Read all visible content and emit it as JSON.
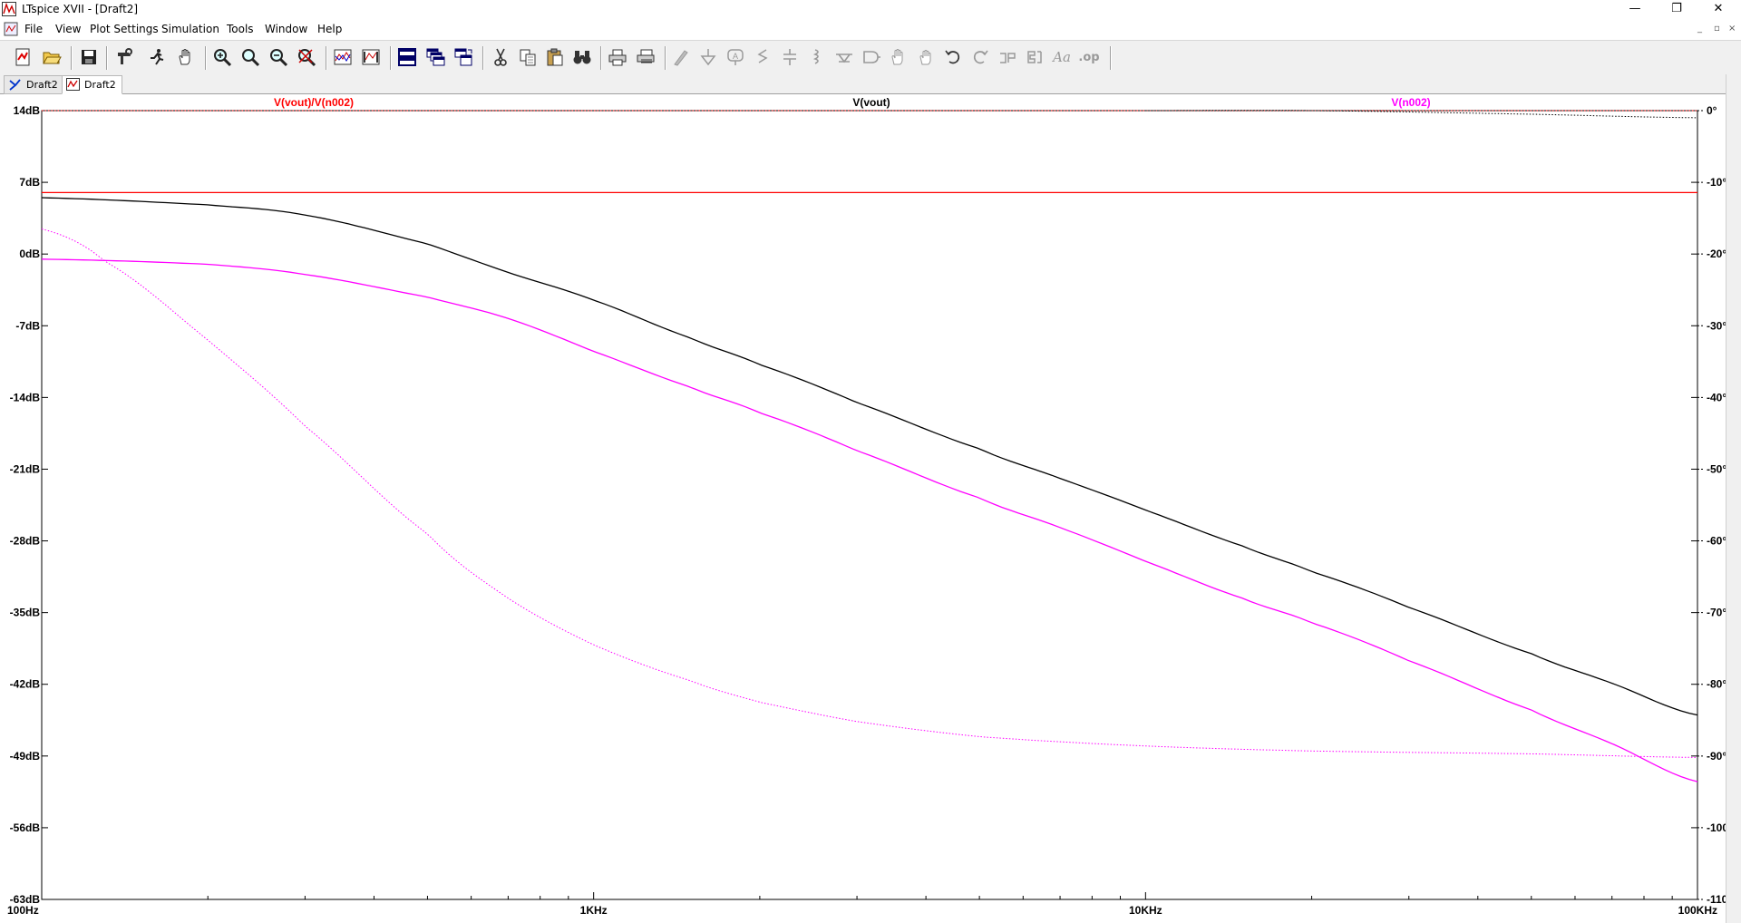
{
  "window": {
    "title": "LTspice XVII - [Draft2]",
    "minimize_glyph": "—",
    "restore_glyph": "❐",
    "close_glyph": "✕"
  },
  "menu": {
    "items": [
      "File",
      "View",
      "Plot Settings",
      "Simulation",
      "Tools",
      "Window",
      "Help"
    ],
    "mdi_minimize": "_",
    "mdi_restore": "▫",
    "mdi_close": "×"
  },
  "toolbar": {
    "icons": [
      "new-schematic-icon",
      "open-icon",
      "save-icon",
      "control-panel-icon",
      "run-icon",
      "halt-icon",
      "zoom-in-icon",
      "zoom-area-icon",
      "zoom-out-icon",
      "zoom-full-icon",
      "autorange-icon",
      "pick-visible-traces-icon",
      "tile-horizontal-icon",
      "cascade-icon",
      "tile-vertical-icon",
      "cut-icon",
      "copy-icon",
      "paste-icon",
      "find-icon",
      "print-icon",
      "print-preview-icon",
      "wire-icon",
      "ground-icon",
      "label-net-icon",
      "resistor-icon",
      "capacitor-icon",
      "inductor-icon",
      "diode-icon",
      "component-icon",
      "move-icon",
      "drag-icon",
      "undo-icon",
      "redo-icon",
      "rotate-icon",
      "mirror-icon",
      "text-icon",
      "spice-directive-icon"
    ],
    "spice_directive_glyph": ".op",
    "text_glyph": "Aa"
  },
  "tabs": [
    {
      "label": "Draft2",
      "icon": "schematic-icon",
      "active": false
    },
    {
      "label": "Draft2",
      "icon": "waveform-icon",
      "active": true
    }
  ],
  "chart_data": {
    "type": "line",
    "x_scale": "log",
    "xlim": [
      100,
      100000
    ],
    "x_ticks": [
      {
        "value": 100,
        "label": "100Hz"
      },
      {
        "value": 1000,
        "label": "1KHz"
      },
      {
        "value": 10000,
        "label": "10KHz"
      },
      {
        "value": 100000,
        "label": "100KHz"
      }
    ],
    "y_left": {
      "unit": "dB",
      "ylim": [
        -63,
        14
      ],
      "ticks": [
        14,
        7,
        0,
        -7,
        -14,
        -21,
        -28,
        -35,
        -42,
        -49,
        -56,
        -63
      ],
      "tick_labels": [
        "14dB",
        "7dB",
        "0dB",
        "-7dB",
        "-14dB",
        "-21dB",
        "-28dB",
        "-35dB",
        "-42dB",
        "-49dB",
        "-56dB",
        "-63dB"
      ]
    },
    "y_right": {
      "unit": "°",
      "ylim": [
        -110,
        0
      ],
      "ticks": [
        0,
        -10,
        -20,
        -30,
        -40,
        -50,
        -60,
        -70,
        -80,
        -90,
        -100,
        -110
      ],
      "tick_labels": [
        "0°",
        "-10°",
        "-20°",
        "-30°",
        "-40°",
        "-50°",
        "-60°",
        "-70°",
        "-80°",
        "-90°",
        "-100°",
        "-110°"
      ]
    },
    "grid": false,
    "background": "#ffffff",
    "series": [
      {
        "name": "V(vout)/V(n002)",
        "color": "#ff0000",
        "label_position": "left",
        "magnitude_db": {
          "x": [
            100,
            100000
          ],
          "y": [
            6.0,
            6.0
          ]
        },
        "phase_deg": {
          "x": [
            100,
            100000
          ],
          "y": [
            0,
            0
          ]
        }
      },
      {
        "name": "V(vout)",
        "color": "#000000",
        "label_position": "center",
        "magnitude_db": {
          "x": [
            100,
            200,
            300,
            500,
            700,
            1000,
            1500,
            2000,
            3000,
            5000,
            7000,
            10000,
            15000,
            20000,
            30000,
            50000,
            70000,
            100000
          ],
          "y": [
            5.5,
            4.8,
            3.8,
            1.0,
            -1.8,
            -4.5,
            -8.2,
            -10.8,
            -14.5,
            -19.0,
            -21.9,
            -25.0,
            -28.5,
            -31.0,
            -34.5,
            -39.0,
            -41.9,
            -45.0
          ]
        },
        "phase_deg": {
          "x": [
            10000,
            20000,
            50000,
            100000
          ],
          "y": [
            0,
            0,
            -0.5,
            -1.0
          ]
        }
      },
      {
        "name": "V(n002)",
        "color": "#ff00ff",
        "label_position": "right",
        "magnitude_db": {
          "x": [
            100,
            200,
            300,
            500,
            700,
            1000,
            1500,
            2000,
            3000,
            5000,
            7000,
            10000,
            15000,
            20000,
            30000,
            50000,
            70000,
            100000
          ],
          "y": [
            -0.5,
            -1.0,
            -2.0,
            -4.2,
            -6.3,
            -9.5,
            -13.0,
            -15.5,
            -19.2,
            -23.8,
            -26.7,
            -30.0,
            -33.6,
            -36.0,
            -39.7,
            -44.5,
            -47.8,
            -51.5
          ]
        },
        "phase_deg": {
          "x": [
            100,
            130,
            200,
            300,
            500,
            700,
            1000,
            1500,
            2000,
            3000,
            5000,
            10000,
            20000,
            50000,
            100000
          ],
          "y": [
            -16.5,
            -21,
            -32,
            -44,
            -59,
            -68,
            -74.5,
            -79.5,
            -82.5,
            -85.2,
            -87.3,
            -88.6,
            -89.3,
            -89.7,
            -90.2
          ]
        }
      }
    ]
  }
}
